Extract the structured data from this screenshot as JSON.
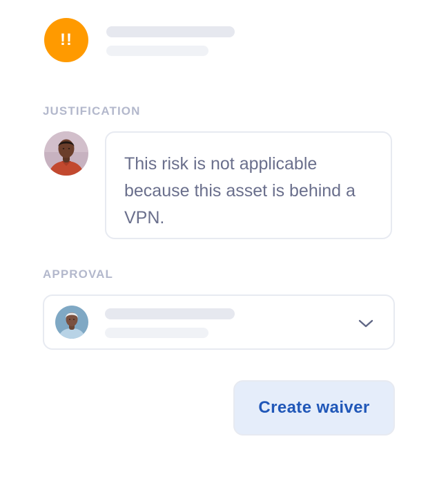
{
  "risk": {
    "icon": "double-exclamation-icon",
    "icon_text": "!!",
    "icon_color": "#ff9a00"
  },
  "justification": {
    "label": "JUSTIFICATION",
    "author_avatar": "user-avatar-man",
    "comment": "This risk is not applicable because this asset is behind a VPN."
  },
  "approval": {
    "label": "APPROVAL",
    "approver_avatar": "user-avatar-woman",
    "dropdown_icon": "chevron-down-icon"
  },
  "actions": {
    "create_waiver_label": "Create waiver"
  },
  "colors": {
    "accent": "#2057b8",
    "button_background": "#e5edfa",
    "label": "#b3b8cc",
    "comment_text": "#6a6f8c",
    "border": "#e7eaf1",
    "skeleton": "#e6e8ef"
  }
}
